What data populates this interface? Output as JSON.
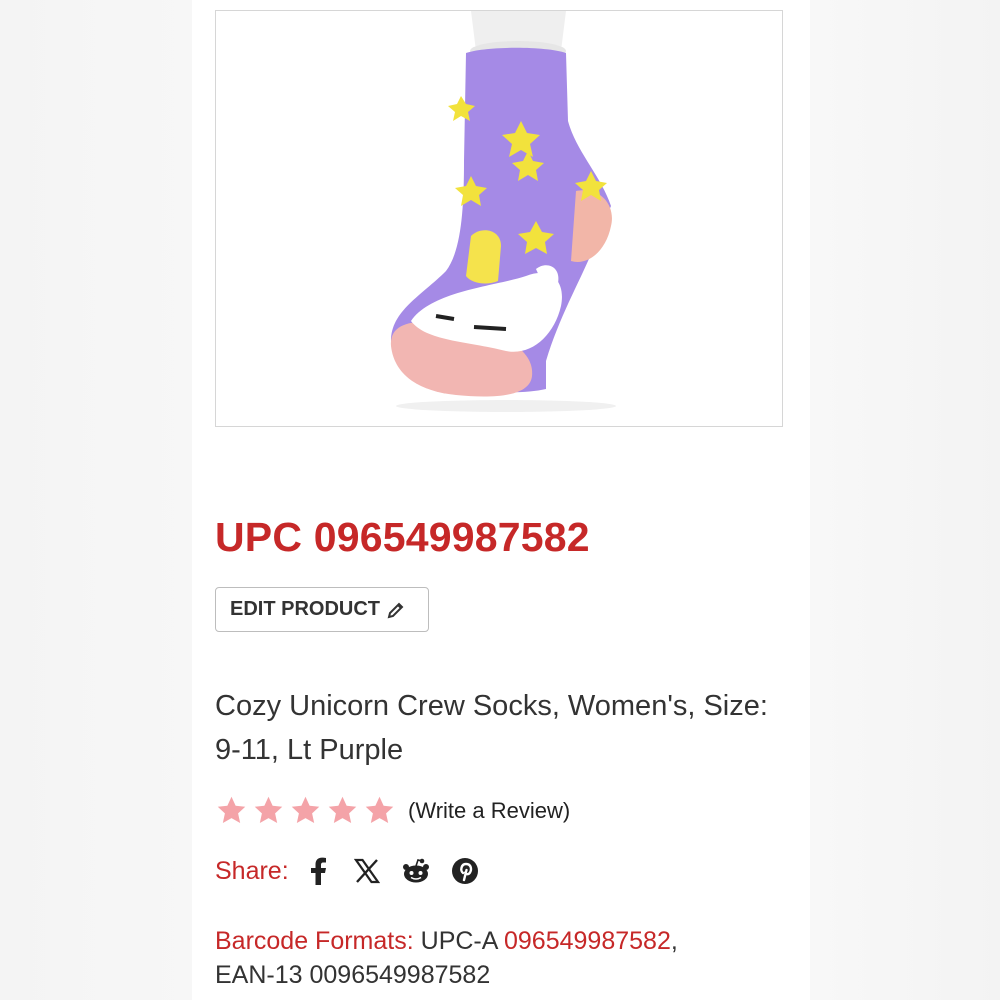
{
  "product": {
    "upc_title": "UPC 096549987582",
    "edit_label": "EDIT PRODUCT",
    "name": "Cozy Unicorn Crew Socks, Women's, Size: 9-11, Lt Purple",
    "image_alt": "unicorn-sock-photo"
  },
  "rating": {
    "stars": 5,
    "filled": 5,
    "review_label": "(Write a Review)",
    "star_color": "#f4a3a8"
  },
  "share": {
    "label": "Share:",
    "icons": [
      "facebook-icon",
      "x-icon",
      "reddit-icon",
      "pinterest-icon"
    ]
  },
  "barcodes": {
    "label": "Barcode Formats:",
    "upca_prefix": "UPC-A",
    "upca_value": "096549987582",
    "separator": ",",
    "ean13": "EAN-13 0096549987582"
  },
  "colors": {
    "accent": "#c62828",
    "text": "#333333"
  }
}
